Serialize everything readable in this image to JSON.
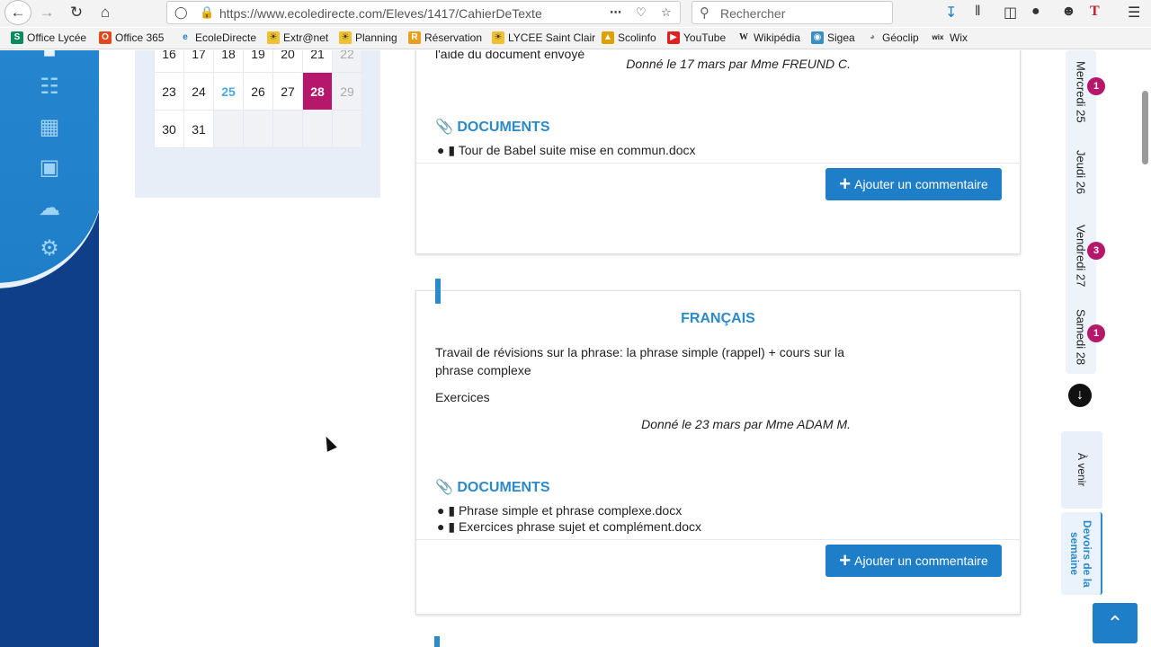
{
  "browser": {
    "url": "https://www.ecoledirecte.com/Eleves/1417/CahierDeTexte",
    "search_placeholder": "Rechercher",
    "bookmarks": [
      "Office Lycée",
      "Office 365",
      "EcoleDirecte",
      "Extr@net",
      "Planning",
      "Réservation",
      "LYCEE Saint Clair",
      "Scolinfo",
      "YouTube",
      "Wikipédia",
      "Sigea",
      "Géoclip",
      "Wix"
    ]
  },
  "calendar": {
    "rows": [
      [
        "16",
        "17",
        "18",
        "19",
        "20",
        "21",
        "22"
      ],
      [
        "23",
        "24",
        "25",
        "26",
        "27",
        "28",
        "29"
      ],
      [
        "30",
        "31",
        "",
        "",
        "",
        "",
        ""
      ]
    ]
  },
  "cards": [
    {
      "text_line": "l'aide du document envoyé",
      "given": "Donné le 17 mars par Mme FREUND C.",
      "documents_title": "DOCUMENTS",
      "documents": [
        "Tour de Babel suite mise en commun.docx"
      ],
      "add_comment": "Ajouter un commentaire"
    },
    {
      "subject": "FRANÇAIS",
      "text_line1": "Travail de révisions sur la phrase:  la phrase simple (rappel) + cours sur la",
      "text_line2": "phrase complexe",
      "text_line3": "Exercices",
      "given": "Donné le 23 mars par Mme ADAM M.",
      "documents_title": "DOCUMENTS",
      "documents": [
        "Phrase simple et phrase complexe.docx",
        "Exercices phrase sujet et complément.docx"
      ],
      "add_comment": "Ajouter un commentaire"
    }
  ],
  "day_tabs": [
    {
      "label": "Mercredi 25",
      "badge": "1"
    },
    {
      "label": "Jeudi 26",
      "badge": ""
    },
    {
      "label": "Vendredi 27",
      "badge": "3"
    },
    {
      "label": "Samedi 28",
      "badge": "1"
    }
  ],
  "side_tabs": {
    "upcoming": "À venir",
    "week": "Devoirs de la semaine"
  },
  "colors": {
    "accent": "#2b8ac9",
    "selected_day": "#b5176b",
    "nav_dark": "#0f3f88"
  }
}
